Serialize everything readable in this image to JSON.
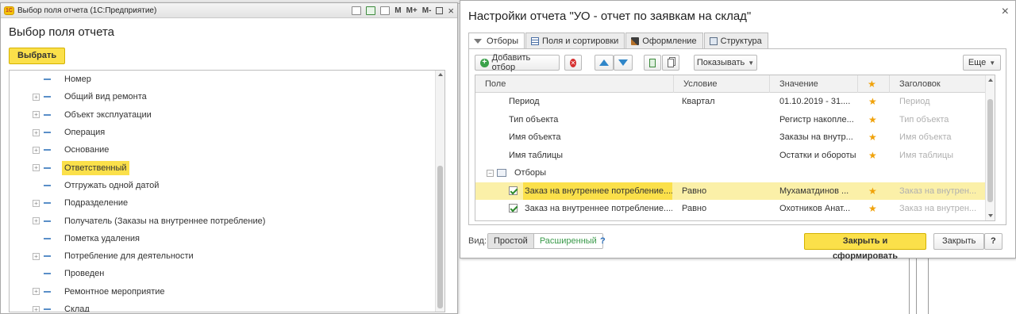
{
  "left_window": {
    "titlebar_text": "Выбор поля отчета  (1С:Предприятие)",
    "titlebar_buttons": {
      "m": "M",
      "mplus": "M+",
      "mminus": "M-"
    },
    "title": "Выбор поля отчета",
    "choose_button": "Выбрать",
    "tree_items": [
      {
        "label": "Номер",
        "expandable": false,
        "selected": false
      },
      {
        "label": "Общий вид ремонта",
        "expandable": true,
        "selected": false
      },
      {
        "label": "Объект эксплуатации",
        "expandable": true,
        "selected": false
      },
      {
        "label": "Операция",
        "expandable": true,
        "selected": false
      },
      {
        "label": "Основание",
        "expandable": true,
        "selected": false
      },
      {
        "label": "Ответственный",
        "expandable": true,
        "selected": true
      },
      {
        "label": "Отгружать одной датой",
        "expandable": false,
        "selected": false
      },
      {
        "label": "Подразделение",
        "expandable": true,
        "selected": false
      },
      {
        "label": "Получатель (Заказы на внутреннее потребление)",
        "expandable": true,
        "selected": false
      },
      {
        "label": "Пометка удаления",
        "expandable": false,
        "selected": false
      },
      {
        "label": "Потребление для деятельности",
        "expandable": true,
        "selected": false
      },
      {
        "label": "Проведен",
        "expandable": false,
        "selected": false
      },
      {
        "label": "Ремонтное мероприятие",
        "expandable": true,
        "selected": false
      },
      {
        "label": "Склад",
        "expandable": true,
        "selected": false
      }
    ]
  },
  "right_window": {
    "title": "Настройки отчета \"УО - отчет по заявкам на склад\"",
    "tabs": [
      {
        "label": "Отборы",
        "icon": "filter-icon",
        "active": true
      },
      {
        "label": "Поля и сортировки",
        "icon": "grid-icon",
        "active": false
      },
      {
        "label": "Оформление",
        "icon": "brush-icon",
        "active": false
      },
      {
        "label": "Структура",
        "icon": "structure-icon",
        "active": false
      }
    ],
    "toolbar": {
      "add_filter": "Добавить отбор",
      "show": "Показывать",
      "more": "Еще"
    },
    "grid": {
      "columns": [
        "Поле",
        "Условие",
        "Значение",
        "Заголовок"
      ],
      "rows": [
        {
          "field": "Период",
          "condition": "Квартал",
          "value": "01.10.2019 - 31....",
          "title": "Период",
          "checkbox": false
        },
        {
          "field": "Тип объекта",
          "condition": "",
          "value": "Регистр накопле...",
          "title": "Тип объекта",
          "checkbox": false
        },
        {
          "field": "Имя объекта",
          "condition": "",
          "value": "Заказы на внутр...",
          "title": "Имя объекта",
          "checkbox": false
        },
        {
          "field": "Имя таблицы",
          "condition": "",
          "value": "Остатки и обороты",
          "title": "Имя таблицы",
          "checkbox": false
        }
      ],
      "group_label": "Отборы",
      "group_rows": [
        {
          "field": "Заказ на внутреннее потребление....",
          "condition": "Равно",
          "value": "Мухаматдинов ...",
          "title": "Заказ на внутрен...",
          "selected": true
        },
        {
          "field": "Заказ на внутреннее потребление....",
          "condition": "Равно",
          "value": "Охотников Анат...",
          "title": "Заказ на внутрен...",
          "selected": false
        }
      ]
    },
    "bottom": {
      "view_label": "Вид:",
      "mode_simple": "Простой",
      "mode_extended": "Расширенный",
      "help_link": "?",
      "close_and_generate": "Закрыть и сформировать",
      "close": "Закрыть",
      "help_button": "?"
    }
  },
  "colors": {
    "accent_yellow": "#fbe04a",
    "selected_row": "#fbf0a8",
    "star": "#f0a20a",
    "link_green": "#3a9a4a"
  }
}
